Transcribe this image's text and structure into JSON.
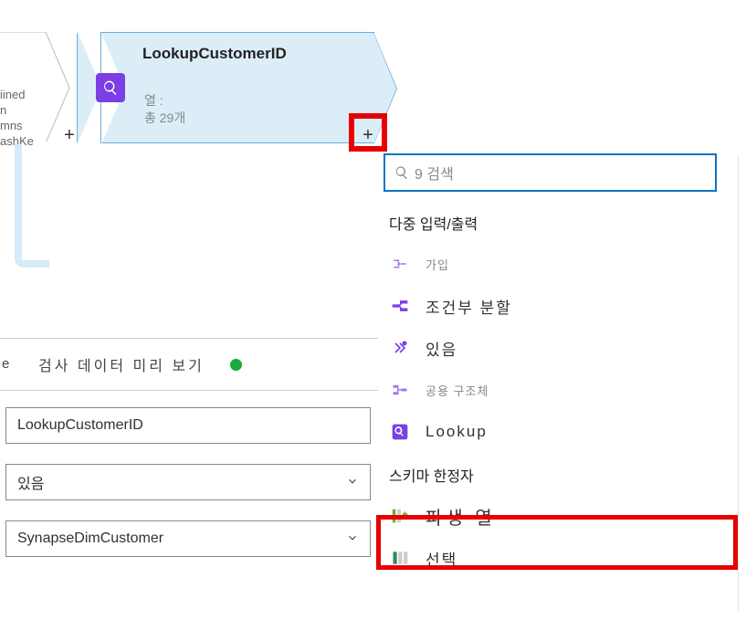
{
  "left_partial_lines": [
    "iined",
    "n",
    "mns",
    "ashKe"
  ],
  "node": {
    "title": "LookupCustomerID",
    "sub1": "열 :",
    "sub2": "총 29개"
  },
  "plus_glyph": "+",
  "popup": {
    "search_placeholder": "9 검색",
    "section1": "다중 입력/출력",
    "items1": [
      {
        "key": "join",
        "label": "가입",
        "small": true
      },
      {
        "key": "split",
        "label": "조건부 분할",
        "small": false
      },
      {
        "key": "exists",
        "label": "있음",
        "small": false
      },
      {
        "key": "union",
        "label": "공용 구조체",
        "small": true
      },
      {
        "key": "lookup",
        "label": "Lookup",
        "small": false
      }
    ],
    "section2": "스키마 한정자",
    "items2": [
      {
        "key": "derived",
        "label": "파생 열"
      },
      {
        "key": "select",
        "label": "선택"
      }
    ]
  },
  "bottom": {
    "left_trunc": "e",
    "header": "검사 데이터 미리 보기",
    "field1": "LookupCustomerID",
    "field2": "있음",
    "field3": "SynapseDimCustomer"
  },
  "colors": {
    "highlight": "#e60000",
    "node_bg": "#dbeef7",
    "node_border": "#6cace0",
    "accent": "#0a73c9",
    "purple": "#7b3fe4"
  }
}
